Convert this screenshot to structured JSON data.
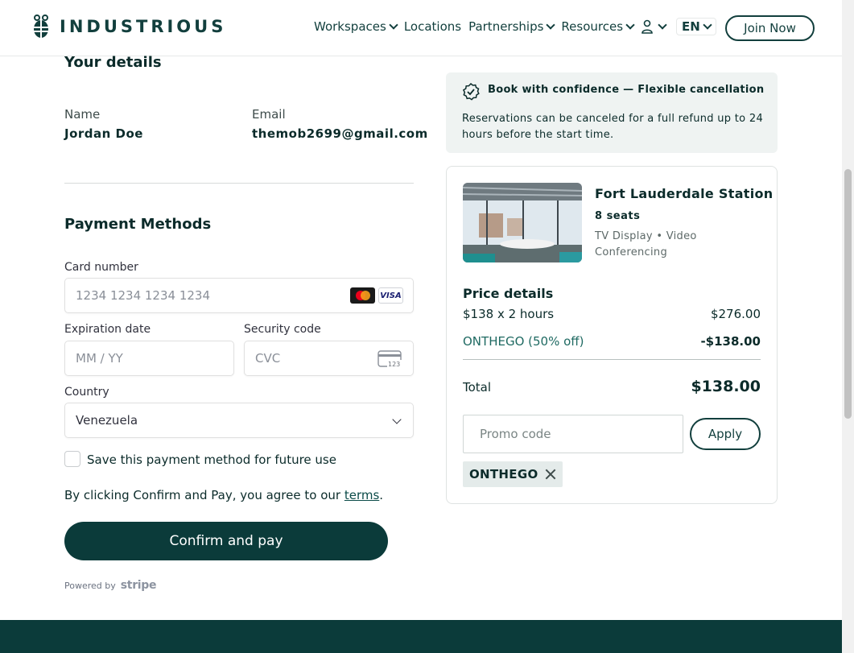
{
  "header": {
    "brand": "INDUSTRIOUS",
    "nav": [
      {
        "label": "Workspaces",
        "dropdown": true
      },
      {
        "label": "Locations",
        "dropdown": false
      },
      {
        "label": "Partnerships",
        "dropdown": true
      },
      {
        "label": "Resources",
        "dropdown": true
      }
    ],
    "language": "EN",
    "join_label": "Join Now"
  },
  "details": {
    "title": "Your details",
    "name_label": "Name",
    "name_value": "Jordan Doe",
    "email_label": "Email",
    "email_value": "themob2699@gmail.com"
  },
  "payment": {
    "title": "Payment Methods",
    "card_label": "Card number",
    "card_placeholder": "1234 1234 1234 1234",
    "card_brands": [
      "mastercard",
      "visa"
    ],
    "visa_text": "VISA",
    "exp_label": "Expiration date",
    "exp_placeholder": "MM / YY",
    "cvc_label": "Security code",
    "cvc_placeholder": "CVC",
    "cvc_icon_text": "123",
    "country_label": "Country",
    "country_value": "Venezuela",
    "save_label": "Save this payment method for future use",
    "save_checked": false,
    "terms_prefix": "By clicking Confirm and Pay, you agree to our ",
    "terms_link": "terms",
    "terms_suffix": ".",
    "confirm_label": "Confirm and pay",
    "powered_by": "Powered by",
    "stripe": "stripe"
  },
  "confidence": {
    "title": "Book with confidence — Flexible cancellation",
    "text": "Reservations can be canceled for a full refund up to 24 hours before the start time."
  },
  "summary": {
    "location": "Fort Lauderdale Station",
    "seats": "8 seats",
    "amenities": "TV Display • Video Conferencing",
    "price_title": "Price details",
    "line_label": "$138 x 2 hours",
    "line_value": "$276.00",
    "discount_label": "ONTHEGO (50% off)",
    "discount_value": "-$138.00",
    "total_label": "Total",
    "total_value": "$138.00",
    "promo_placeholder": "Promo code",
    "apply_label": "Apply",
    "applied_code": "ONTHEGO"
  },
  "colors": {
    "brand": "#0b3b3a",
    "accent_text": "#1f6a62",
    "confidence_bg": "#eff3f2"
  }
}
